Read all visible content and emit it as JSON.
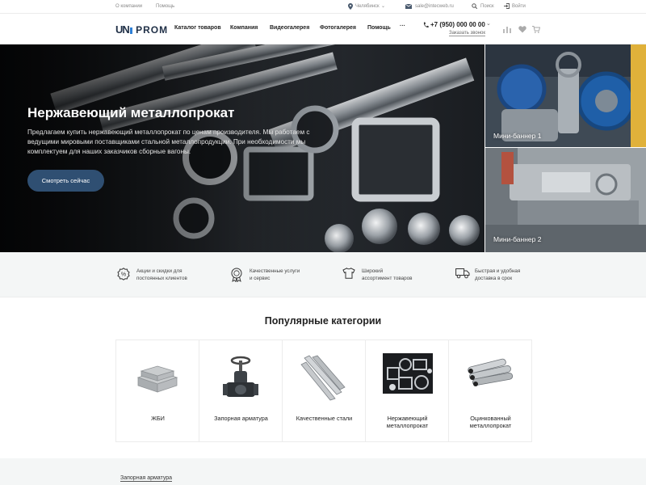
{
  "topbar": {
    "about": "О компании",
    "help": "Помощь",
    "city": "Челябинск",
    "email": "sale@intecweb.ru",
    "search": "Поиск",
    "login": "Войти"
  },
  "header": {
    "logo_un": "UN",
    "logo_prom": "PROM",
    "nav": [
      "Каталог товаров",
      "Компания",
      "Видеогалерея",
      "Фотогалерея",
      "Помощь",
      "···"
    ],
    "phone": "+7 (950) 000 00 00",
    "callback": "Заказать звонок"
  },
  "hero": {
    "title": "Нержавеющий металлопрокат",
    "text": "Предлагаем купить нержавеющий металлопрокат по ценам производителя. Мы работаем с ведущими мировыми поставщиками стальной металлопродукции. При необходимости мы комплектуем для наших заказчиков сборные вагоны.",
    "button": "Смотреть сейчас"
  },
  "banners": [
    "Мини-баннер 1",
    "Мини-баннер 2"
  ],
  "features": [
    {
      "icon": "percent-badge-icon",
      "text": "Акции и скидки для\nпостоянных клиентов"
    },
    {
      "icon": "award-medal-icon",
      "text": "Качественные услуги\nи сервис"
    },
    {
      "icon": "tshirt-icon",
      "text": "Широкий\nассортимент товаров"
    },
    {
      "icon": "delivery-truck-icon",
      "text": "Быстрая и удобная\nдоставка в срок"
    }
  ],
  "categories": {
    "title": "Популярные категории",
    "items": [
      "ЖБИ",
      "Запорная арматура",
      "Качественные стали",
      "Нержавеющий металлопрокат",
      "Оцинкованный металлопрокат"
    ]
  },
  "bottom": {
    "link": "Запорная арматура"
  },
  "colors": {
    "primary": "#2f4f72",
    "logo": "#1f2f46",
    "accent": "#2d7fd6"
  }
}
